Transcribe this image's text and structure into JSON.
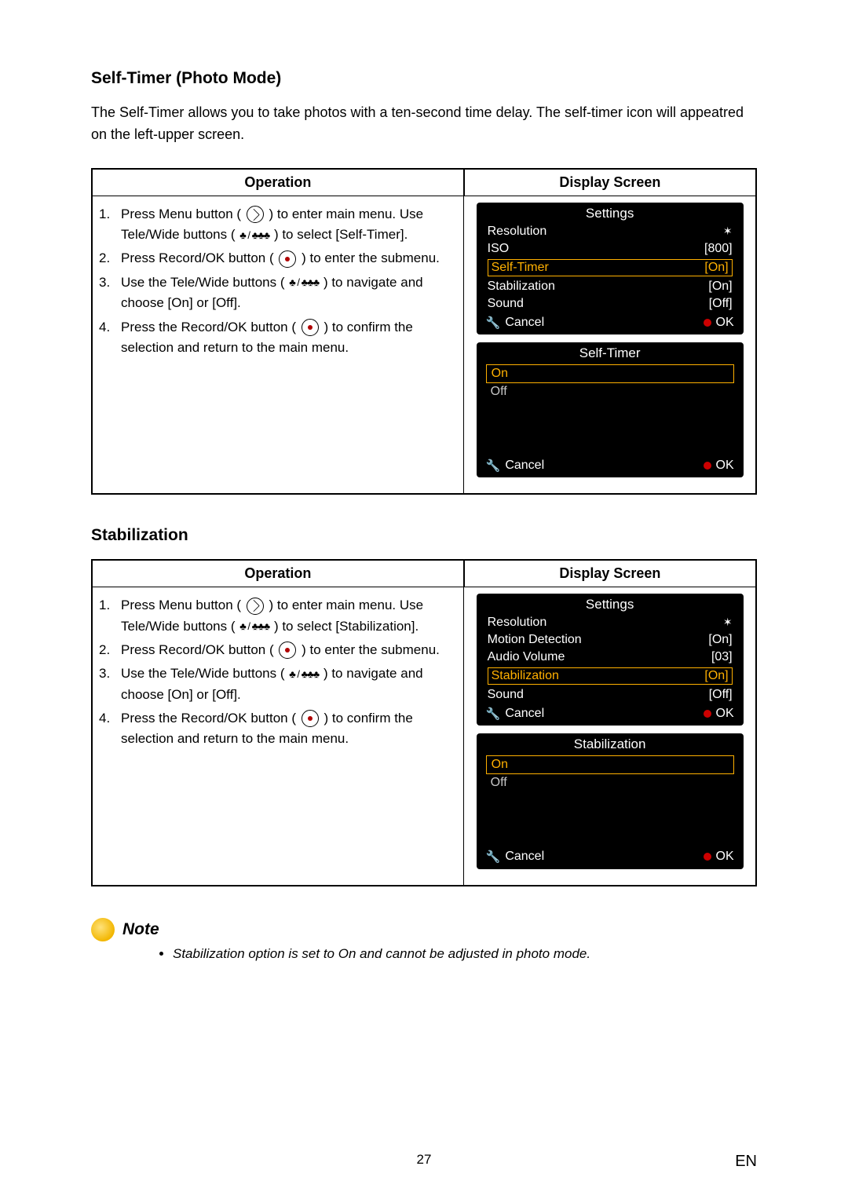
{
  "page": {
    "number": "27",
    "lang": "EN"
  },
  "selftimer": {
    "heading": "Self-Timer (Photo Mode)",
    "intro": "The Self-Timer allows you to take photos with a ten-second time delay. The self-timer icon will appeatred on the left-upper screen.",
    "table": {
      "col_operation": "Operation",
      "col_display": "Display Screen",
      "steps": {
        "n1": "1.",
        "s1a": "Press Menu button (",
        "s1b": ") to enter main menu. Use Tele/Wide buttons (",
        "s1c": ") to select [Self-Timer].",
        "n2": "2.",
        "s2a": "Press Record/OK button (",
        "s2b": ") to enter the submenu.",
        "n3": "3.",
        "s3a": "Use the Tele/Wide buttons (",
        "s3b": ") to navigate and choose [On] or [Off].",
        "n4": "4.",
        "s4a": "Press the Record/OK button (",
        "s4b": ") to confirm the selection and return to the main menu."
      }
    },
    "lcd_main": {
      "title": "Settings",
      "rows": [
        {
          "label": "Resolution",
          "value": "",
          "star": true,
          "sel": false
        },
        {
          "label": "ISO",
          "value": "[800]",
          "sel": false
        },
        {
          "label": "Self-Timer",
          "value": "[On]",
          "sel": true
        },
        {
          "label": "Stabilization",
          "value": "[On]",
          "sel": false
        },
        {
          "label": "Sound",
          "value": "[Off]",
          "sel": false
        }
      ],
      "cancel": "Cancel",
      "ok": "OK"
    },
    "lcd_sub": {
      "title": "Self-Timer",
      "on": "On",
      "off": "Off",
      "cancel": "Cancel",
      "ok": "OK"
    }
  },
  "stab": {
    "heading": "Stabilization",
    "table": {
      "col_operation": "Operation",
      "col_display": "Display Screen",
      "steps": {
        "n1": "1.",
        "s1a": "Press Menu button (",
        "s1b": ") to enter main menu. Use Tele/Wide buttons (",
        "s1c": ") to select [Stabilization].",
        "n2": "2.",
        "s2a": "Press Record/OK button (",
        "s2b": ") to enter the submenu.",
        "n3": "3.",
        "s3a": "Use the Tele/Wide buttons (",
        "s3b": ")  to navigate and choose [On] or [Off].",
        "n4": "4.",
        "s4a": "Press the Record/OK button (",
        "s4b": ") to confirm the selection and return to the main menu."
      }
    },
    "lcd_main": {
      "title": "Settings",
      "rows": [
        {
          "label": "Resolution",
          "value": "",
          "star": true,
          "sel": false
        },
        {
          "label": "Motion Detection",
          "value": "[On]",
          "sel": false
        },
        {
          "label": "Audio Volume",
          "value": "[03]",
          "sel": false
        },
        {
          "label": "Stabilization",
          "value": "[On]",
          "sel": true
        },
        {
          "label": "Sound",
          "value": "[Off]",
          "sel": false
        }
      ],
      "cancel": "Cancel",
      "ok": "OK"
    },
    "lcd_sub": {
      "title": "Stabilization",
      "on": "On",
      "off": "Off",
      "cancel": "Cancel",
      "ok": "OK"
    }
  },
  "note": {
    "heading": "Note",
    "item": "Stabilization option is set to On and cannot be adjusted in photo mode."
  },
  "glyph": {
    "tele_wide": "♣ / ♣♣♣",
    "star": "✶"
  }
}
